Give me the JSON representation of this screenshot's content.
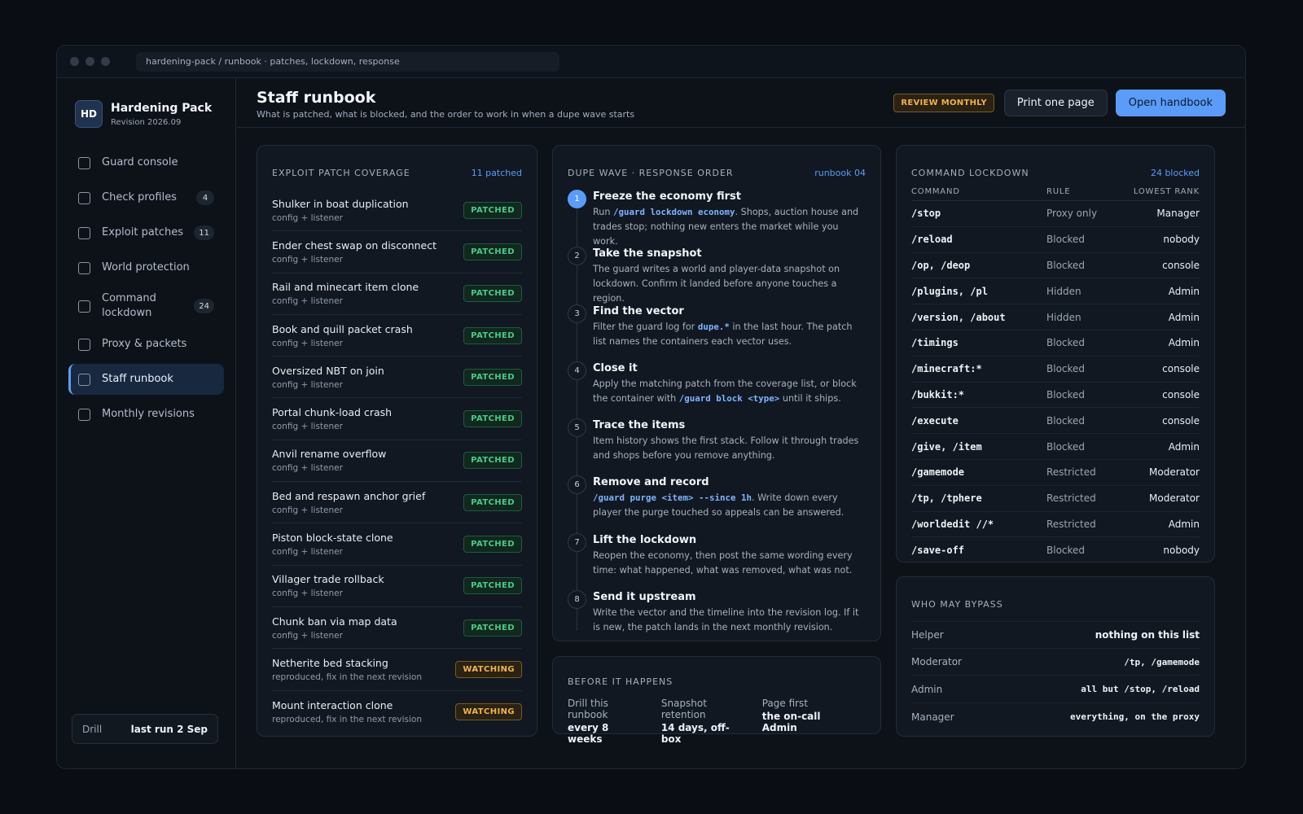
{
  "window": {
    "address": "hardening-pack / runbook · patches, lockdown, response"
  },
  "brand": {
    "logo": "HD",
    "name": "Hardening Pack",
    "revision": "Revision 2026.09"
  },
  "nav": [
    {
      "label": "Guard console",
      "badge": ""
    },
    {
      "label": "Check profiles",
      "badge": "4"
    },
    {
      "label": "Exploit patches",
      "badge": "11"
    },
    {
      "label": "World protection",
      "badge": ""
    },
    {
      "label": "Command lockdown",
      "badge": "24"
    },
    {
      "label": "Proxy & packets",
      "badge": ""
    },
    {
      "label": "Staff runbook",
      "badge": "",
      "active": true
    },
    {
      "label": "Monthly revisions",
      "badge": ""
    }
  ],
  "drill": {
    "label": "Drill",
    "value": "last run 2 Sep"
  },
  "header": {
    "title": "Staff runbook",
    "subtitle": "What is patched, what is blocked, and the order to work in when a dupe wave starts",
    "review_badge": "REVIEW MONTHLY",
    "print_label": "Print one page",
    "open_label": "Open handbook"
  },
  "patches": {
    "title": "EXPLOIT PATCH COVERAGE",
    "count": "11 patched",
    "items": [
      {
        "name": "Shulker in boat duplication",
        "sub": "config + listener",
        "status": "PATCHED"
      },
      {
        "name": "Ender chest swap on disconnect",
        "sub": "config + listener",
        "status": "PATCHED"
      },
      {
        "name": "Rail and minecart item clone",
        "sub": "config + listener",
        "status": "PATCHED"
      },
      {
        "name": "Book and quill packet crash",
        "sub": "config + listener",
        "status": "PATCHED"
      },
      {
        "name": "Oversized NBT on join",
        "sub": "config + listener",
        "status": "PATCHED"
      },
      {
        "name": "Portal chunk-load crash",
        "sub": "config + listener",
        "status": "PATCHED"
      },
      {
        "name": "Anvil rename overflow",
        "sub": "config + listener",
        "status": "PATCHED"
      },
      {
        "name": "Bed and respawn anchor grief",
        "sub": "config + listener",
        "status": "PATCHED"
      },
      {
        "name": "Piston block-state clone",
        "sub": "config + listener",
        "status": "PATCHED"
      },
      {
        "name": "Villager trade rollback",
        "sub": "config + listener",
        "status": "PATCHED"
      },
      {
        "name": "Chunk ban via map data",
        "sub": "config + listener",
        "status": "PATCHED"
      },
      {
        "name": "Netherite bed stacking",
        "sub": "reproduced, fix in the next revision",
        "status": "WATCHING"
      },
      {
        "name": "Mount interaction clone",
        "sub": "reproduced, fix in the next revision",
        "status": "WATCHING"
      }
    ]
  },
  "runbook": {
    "title": "DUPE WAVE · RESPONSE ORDER",
    "tag": "runbook 04",
    "steps": [
      {
        "n": "1",
        "title": "Freeze the economy first",
        "pre": "Run ",
        "code": "/guard lockdown economy",
        "post": ". Shops, auction house and trades stop; nothing new enters the market while you work."
      },
      {
        "n": "2",
        "title": "Take the snapshot",
        "pre": "The guard writes a world and player-data snapshot on lockdown. Confirm it landed before anyone touches a region.",
        "code": "",
        "post": ""
      },
      {
        "n": "3",
        "title": "Find the vector",
        "pre": "Filter the guard log for ",
        "code": "dupe.*",
        "post": " in the last hour. The patch list names the containers each vector uses."
      },
      {
        "n": "4",
        "title": "Close it",
        "pre": "Apply the matching patch from the coverage list, or block the container with ",
        "code": "/guard block <type>",
        "post": " until it ships."
      },
      {
        "n": "5",
        "title": "Trace the items",
        "pre": "Item history shows the first stack. Follow it through trades and shops before you remove anything.",
        "code": "",
        "post": ""
      },
      {
        "n": "6",
        "title": "Remove and record",
        "pre": "",
        "code": "/guard purge <item> --since 1h",
        "post": ". Write down every player the purge touched so appeals can be answered."
      },
      {
        "n": "7",
        "title": "Lift the lockdown",
        "pre": "Reopen the economy, then post the same wording every time: what happened, what was removed, what was not.",
        "code": "",
        "post": ""
      },
      {
        "n": "8",
        "title": "Send it upstream",
        "pre": "Write the vector and the timeline into the revision log. If it is new, the patch lands in the next monthly revision.",
        "code": "",
        "post": ""
      }
    ]
  },
  "before": {
    "title": "BEFORE IT HAPPENS",
    "items": [
      {
        "label": "Drill this runbook",
        "value": "every 8 weeks"
      },
      {
        "label": "Snapshot retention",
        "value": "14 days, off-box"
      },
      {
        "label": "Page first",
        "value": "the on-call Admin"
      }
    ]
  },
  "commands": {
    "title": "COMMAND LOCKDOWN",
    "count": "24 blocked",
    "headers": [
      "COMMAND",
      "RULE",
      "LOWEST RANK"
    ],
    "rows": [
      [
        "/stop",
        "Proxy only",
        "Manager"
      ],
      [
        "/reload",
        "Blocked",
        "nobody"
      ],
      [
        "/op, /deop",
        "Blocked",
        "console"
      ],
      [
        "/plugins, /pl",
        "Hidden",
        "Admin"
      ],
      [
        "/version, /about",
        "Hidden",
        "Admin"
      ],
      [
        "/timings",
        "Blocked",
        "Admin"
      ],
      [
        "/minecraft:*",
        "Blocked",
        "console"
      ],
      [
        "/bukkit:*",
        "Blocked",
        "console"
      ],
      [
        "/execute",
        "Blocked",
        "console"
      ],
      [
        "/give, /item",
        "Blocked",
        "Admin"
      ],
      [
        "/gamemode",
        "Restricted",
        "Moderator"
      ],
      [
        "/tp, /tphere",
        "Restricted",
        "Moderator"
      ],
      [
        "/worldedit //*",
        "Restricted",
        "Admin"
      ],
      [
        "/save-off",
        "Blocked",
        "nobody"
      ]
    ]
  },
  "bypass": {
    "title": "WHO MAY BYPASS",
    "rows": [
      {
        "role": "Helper",
        "value": "nothing on this list",
        "mono": false
      },
      {
        "role": "Moderator",
        "value": "/tp, /gamemode",
        "mono": true
      },
      {
        "role": "Admin",
        "value": "all but /stop, /reload",
        "mono": true
      },
      {
        "role": "Manager",
        "value": "everything, on the proxy",
        "mono": true
      }
    ]
  }
}
